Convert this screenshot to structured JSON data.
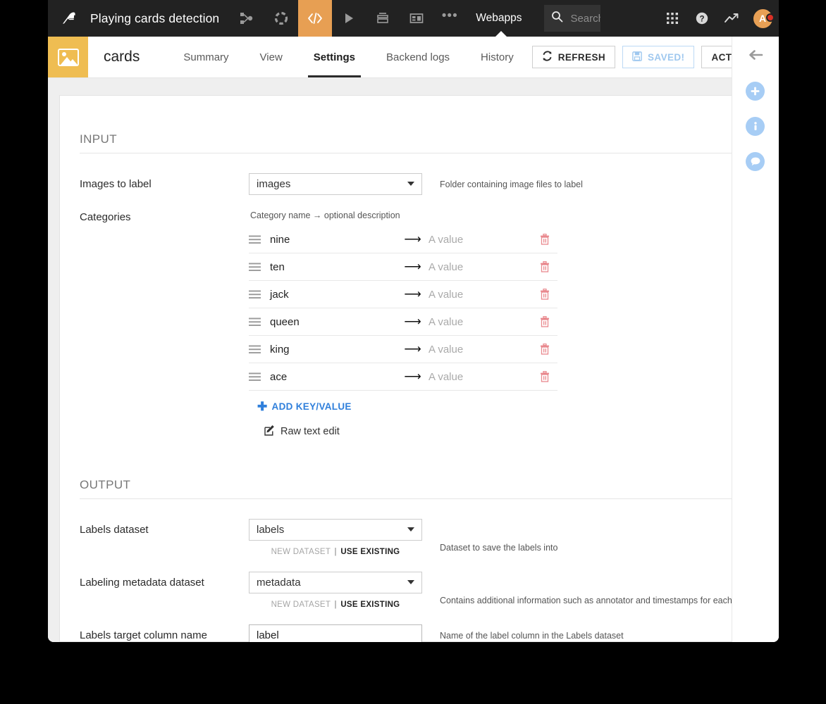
{
  "topbar": {
    "logo_icon": "dataiku-bird-logo",
    "project_title": "Playing cards detection",
    "icons": [
      {
        "name": "flow-icon",
        "label": "Flow"
      },
      {
        "name": "dashed-circle-icon",
        "label": "Datasets"
      },
      {
        "name": "code-icon",
        "label": "</>",
        "active": true
      },
      {
        "name": "play-icon",
        "label": "Run"
      },
      {
        "name": "stack-icon",
        "label": "Jobs"
      },
      {
        "name": "dashboard-icon",
        "label": "Dashboards"
      }
    ],
    "more_dots": "•••",
    "current_section": "Webapps",
    "search_placeholder": "Search",
    "right_icons": [
      {
        "name": "apps-grid-icon"
      },
      {
        "name": "help-icon"
      },
      {
        "name": "trending-icon"
      }
    ],
    "avatar_initial": "A",
    "notification": true
  },
  "subheader": {
    "app_icon": "image-app-icon",
    "app_name": "cards",
    "tabs": [
      {
        "label": "Summary",
        "active": false
      },
      {
        "label": "View",
        "active": false
      },
      {
        "label": "Settings",
        "active": true
      },
      {
        "label": "Backend logs",
        "active": false
      },
      {
        "label": "History",
        "active": false
      }
    ],
    "refresh_label": "REFRESH",
    "saved_label": "SAVED!",
    "actions_label": "ACTIONS"
  },
  "input_section": {
    "title": "INPUT",
    "images_label": "Images to label",
    "images_value": "images",
    "images_help": "Folder containing image files to label",
    "categories_label": "Categories",
    "categories_hint": "Category name → optional description",
    "value_placeholder": "A value",
    "arrow": "⟶",
    "rows": [
      {
        "key": "nine",
        "value": ""
      },
      {
        "key": "ten",
        "value": ""
      },
      {
        "key": "jack",
        "value": ""
      },
      {
        "key": "queen",
        "value": ""
      },
      {
        "key": "king",
        "value": ""
      },
      {
        "key": "ace",
        "value": ""
      }
    ],
    "add_kv_label": "ADD KEY/VALUE",
    "add_kv_plus": "✚",
    "raw_text_edit_label": "Raw text edit"
  },
  "output_section": {
    "title": "OUTPUT",
    "labels_dataset_label": "Labels dataset",
    "labels_dataset_value": "labels",
    "labels_dataset_help": "Dataset to save the labels into",
    "metadata_dataset_label": "Labeling metadata dataset",
    "metadata_dataset_value": "metadata",
    "metadata_dataset_help": "Contains additional information such as annotator and timestamps for each labeling",
    "target_column_label": "Labels target column name",
    "target_column_value": "label",
    "target_column_help": "Name of the label column in the Labels dataset",
    "new_dataset_label": "NEW DATASET",
    "use_existing_label": "USE EXISTING",
    "separator": "|"
  },
  "right_rail": {
    "items": [
      {
        "name": "collapse-arrow-icon",
        "glyph": "←"
      },
      {
        "name": "add-icon",
        "glyph": "+"
      },
      {
        "name": "info-icon",
        "glyph": "i"
      },
      {
        "name": "discussion-icon",
        "glyph": "💬"
      }
    ]
  },
  "colors": {
    "topbar_bg": "#222222",
    "accent_orange": "#e79f53",
    "app_icon_yellow": "#efbd52",
    "link_blue": "#2f7fdb",
    "delete_red": "#e9898e",
    "rail_blue": "#a7cdf5"
  }
}
